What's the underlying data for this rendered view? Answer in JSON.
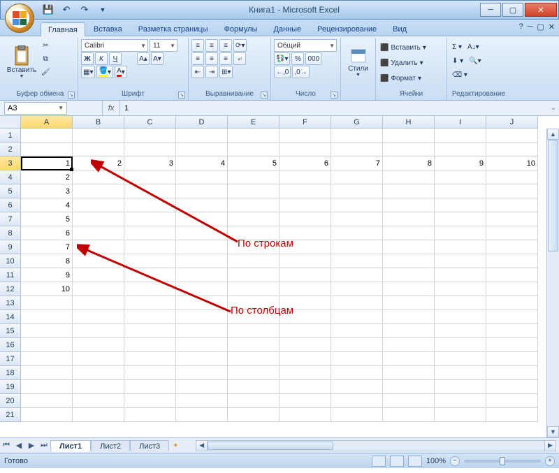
{
  "window": {
    "title": "Книга1 - Microsoft Excel"
  },
  "qat": {
    "save": "💾",
    "undo": "↶",
    "redo": "↷"
  },
  "tabs": {
    "home": "Главная",
    "insert": "Вставка",
    "layout": "Разметка страницы",
    "formulas": "Формулы",
    "data": "Данные",
    "review": "Рецензирование",
    "view": "Вид"
  },
  "ribbon": {
    "clipboard": {
      "label": "Буфер обмена",
      "paste": "Вставить"
    },
    "font": {
      "label": "Шрифт",
      "name": "Calibri",
      "size": "11",
      "bold": "Ж",
      "italic": "К",
      "underline": "Ч"
    },
    "align": {
      "label": "Выравнивание"
    },
    "number": {
      "label": "Число",
      "format": "Общий"
    },
    "styles": {
      "label": "Стили"
    },
    "cells": {
      "label": "Ячейки",
      "insert": "Вставить",
      "delete": "Удалить",
      "format": "Формат"
    },
    "editing": {
      "label": "Редактирование"
    }
  },
  "fxbar": {
    "namebox": "A3",
    "fx": "fx",
    "formula": "1"
  },
  "grid": {
    "columns": [
      "A",
      "B",
      "C",
      "D",
      "E",
      "F",
      "G",
      "H",
      "I",
      "J"
    ],
    "rows": [
      "1",
      "2",
      "3",
      "4",
      "5",
      "6",
      "7",
      "8",
      "9",
      "10",
      "11",
      "12",
      "13",
      "14",
      "15",
      "16",
      "17",
      "18",
      "19",
      "20",
      "21"
    ],
    "active": "A3",
    "row3": [
      "1",
      "2",
      "3",
      "4",
      "5",
      "6",
      "7",
      "8",
      "9",
      "10"
    ],
    "colA": {
      "4": "2",
      "5": "3",
      "6": "4",
      "7": "5",
      "8": "6",
      "9": "7",
      "10": "8",
      "11": "9",
      "12": "10"
    }
  },
  "sheets": {
    "s1": "Лист1",
    "s2": "Лист2",
    "s3": "Лист3"
  },
  "status": {
    "ready": "Готово",
    "zoom": "100%"
  },
  "annotations": {
    "rows": "По строкам",
    "cols": "По столбцам"
  }
}
